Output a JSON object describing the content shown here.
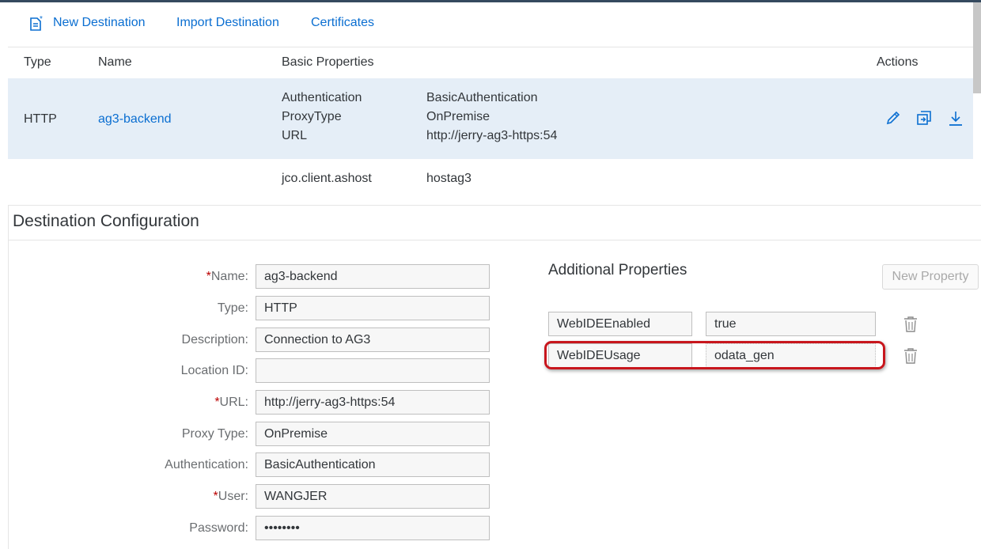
{
  "toolbar": {
    "new_destination": "New Destination",
    "import_destination": "Import Destination",
    "certificates": "Certificates"
  },
  "table": {
    "headers": {
      "type": "Type",
      "name": "Name",
      "basic_properties": "Basic Properties",
      "actions": "Actions"
    },
    "row": {
      "type": "HTTP",
      "name": "ag3-backend",
      "prop_keys": [
        "Authentication",
        "ProxyType",
        "URL"
      ],
      "prop_values": [
        "BasicAuthentication",
        "OnPremise",
        "http://jerry-ag3-https:54"
      ]
    },
    "row2": {
      "prop_key": "jco.client.ashost",
      "prop_value": "hostag3"
    }
  },
  "config": {
    "title": "Destination Configuration",
    "required_mark": "*",
    "fields": [
      {
        "label": "Name:",
        "value": "ag3-backend"
      },
      {
        "label": "Type:",
        "value": "HTTP"
      },
      {
        "label": "Description:",
        "value": "Connection to AG3"
      },
      {
        "label": "Location ID:",
        "value": ""
      },
      {
        "label": "URL:",
        "value": "http://jerry-ag3-https:54"
      },
      {
        "label": "Proxy Type:",
        "value": "OnPremise"
      },
      {
        "label": "Authentication:",
        "value": "BasicAuthentication"
      },
      {
        "label": "User:",
        "value": "WANGJER"
      },
      {
        "label": "Password:",
        "value": "••••••••"
      }
    ]
  },
  "additional": {
    "title": "Additional Properties",
    "new_property": "New Property",
    "props": [
      {
        "key": "WebIDEEnabled",
        "value": "true"
      },
      {
        "key": "WebIDEUsage",
        "value": "odata_gen"
      }
    ]
  },
  "colors": {
    "link": "#0a6ed1",
    "selected_row": "#e5eef7",
    "required": "#bb0000",
    "highlight": "#c8161d"
  },
  "icons": [
    "new-destination-icon",
    "edit-icon",
    "clone-icon",
    "download-icon",
    "trash-icon"
  ]
}
